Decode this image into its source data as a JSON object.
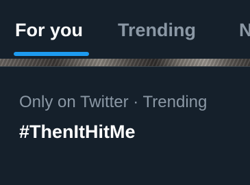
{
  "tabs": [
    {
      "label": "For you",
      "active": true
    },
    {
      "label": "Trending",
      "active": false
    },
    {
      "label": "N",
      "active": false
    }
  ],
  "trend": {
    "meta": "Only on Twitter · Trending",
    "title": "#ThenItHitMe"
  },
  "colors": {
    "background": "#15202b",
    "accent": "#1d9bf0",
    "muted_text": "#8b98a5",
    "primary_text": "#ffffff",
    "divider": "#38444d"
  }
}
